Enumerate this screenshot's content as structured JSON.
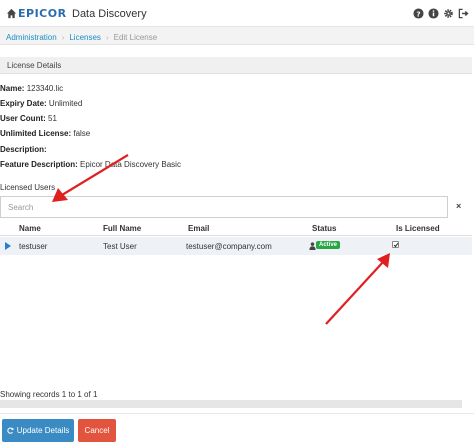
{
  "app": {
    "logo_text": "EPICOR",
    "title": "Data Discovery"
  },
  "breadcrumb": {
    "items": [
      "Administration",
      "Licenses",
      "Edit License"
    ]
  },
  "panel": {
    "title": "License Details"
  },
  "details": [
    {
      "label": "Name:",
      "value": "123340.lic"
    },
    {
      "label": "Expiry Date:",
      "value": "Unlimited"
    },
    {
      "label": "User Count:",
      "value": "51"
    },
    {
      "label": "Unlimited License:",
      "value": "false"
    },
    {
      "label": "Description:",
      "value": ""
    },
    {
      "label": "Feature Description:",
      "value": "Epicor Data Discovery Basic"
    }
  ],
  "licensed_users": {
    "title": "Licensed Users",
    "search_placeholder": "Search",
    "clear_label": "×",
    "columns": [
      "Name",
      "Full Name",
      "Email",
      "Status",
      "Is Licensed"
    ],
    "rows": [
      {
        "name": "testuser",
        "full_name": "Test User",
        "email": "testuser@company.com",
        "status": "Active",
        "is_licensed": true
      }
    ],
    "records_text": "Showing records 1 to 1 of 1"
  },
  "buttons": {
    "update": "Update Details",
    "cancel": "Cancel"
  },
  "colors": {
    "accent": "#1a8fc3",
    "update_button": "#3a8bc4",
    "cancel_button": "#e2543d",
    "active_badge": "#27a844",
    "annotation_arrow": "#e02020"
  },
  "icons": [
    "home-icon",
    "help-icon",
    "info-icon",
    "settings-icon",
    "logout-icon",
    "user-icon",
    "refresh-icon",
    "check-icon",
    "expand-icon"
  ]
}
